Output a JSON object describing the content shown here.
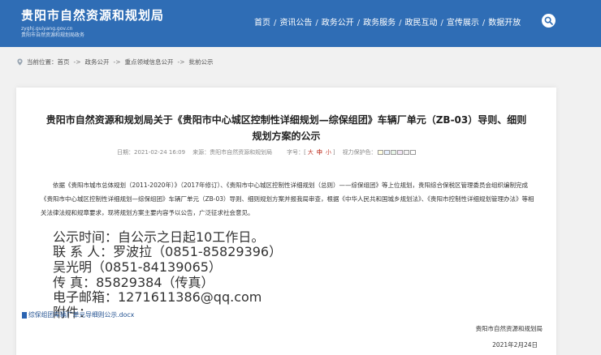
{
  "header": {
    "site_title": "贵阳市自然资源和规划局",
    "site_url": "zyghj.guiyang.gov.cn",
    "site_sub": "贵阳市自然资源和规划局政务",
    "nav": [
      {
        "label": "首页"
      },
      {
        "label": "资讯公告"
      },
      {
        "label": "政务公开"
      },
      {
        "label": "政务服务"
      },
      {
        "label": "政民互动"
      },
      {
        "label": "宣传展示"
      },
      {
        "label": "数据开放"
      }
    ],
    "nav_separator": "/",
    "search_icon": "search-icon"
  },
  "breadcrumb": {
    "prefix": "当前位置：",
    "items": [
      "首页",
      "政务公开",
      "重点领域信息公开",
      "批前公示"
    ],
    "separator": "->"
  },
  "article": {
    "title": "贵阳市自然资源和规划局关于《贵阳市中心城区控制性详细规划—综保组团》车辆厂单元（ZB-03）导则、细则规划方案的公示",
    "date_label": "日期：2021-02-24 16:09",
    "source_label": "来源：贵阳市自然资源和规划局",
    "font_size_label": "字号：",
    "size_options": {
      "large": "大",
      "medium": "中",
      "small": "小"
    },
    "font_size_brackets": {
      "open": "[",
      "close": "]"
    },
    "vision_label": "视力保护色：",
    "vision_colors": [
      "#fffde0",
      "#e6f0ff",
      "#e8f5e9",
      "#f3e5f5",
      "#f5f5f5",
      "#ffffff"
    ],
    "body_paragraph": "依据《贵阳市城市总体规划（2011-2020年）》（2017年修订）、《贵阳市中心城区控制性详细规划（总则）——综保组团》等上位规划，贵阳综合保税区管理委员会组织编制完成《贵阳市中心城区控制性详细规划—综保组团》车辆厂单元（ZB-03）导则、细则规划方案并报我局审查，根据《中华人民共和国城乡规划法》、《贵阳市控制性详细规划管理办法》等相关法律法规和规章要求，现将规划方案主要内容予以公告，广泛征求社会意见。",
    "lines": [
      "公示时间：自公示之日起10工作日。",
      "联 系 人：罗波拉（0851-85829396）",
      "吴光明（0851-84139065）",
      "传      真：85829384（传真）",
      "电子邮箱：1271611386@qq.com",
      "附件："
    ],
    "attachment": "综保组团车辆厂单元导细则公示.docx",
    "signature": "贵阳市自然资源和规划局",
    "sign_date": "2021年2月24日"
  },
  "colors": {
    "header_bg": "#2f6db5",
    "page_bg": "#f1f1f1",
    "link": "#1f4f8f",
    "accent_red": "#c0392b"
  }
}
